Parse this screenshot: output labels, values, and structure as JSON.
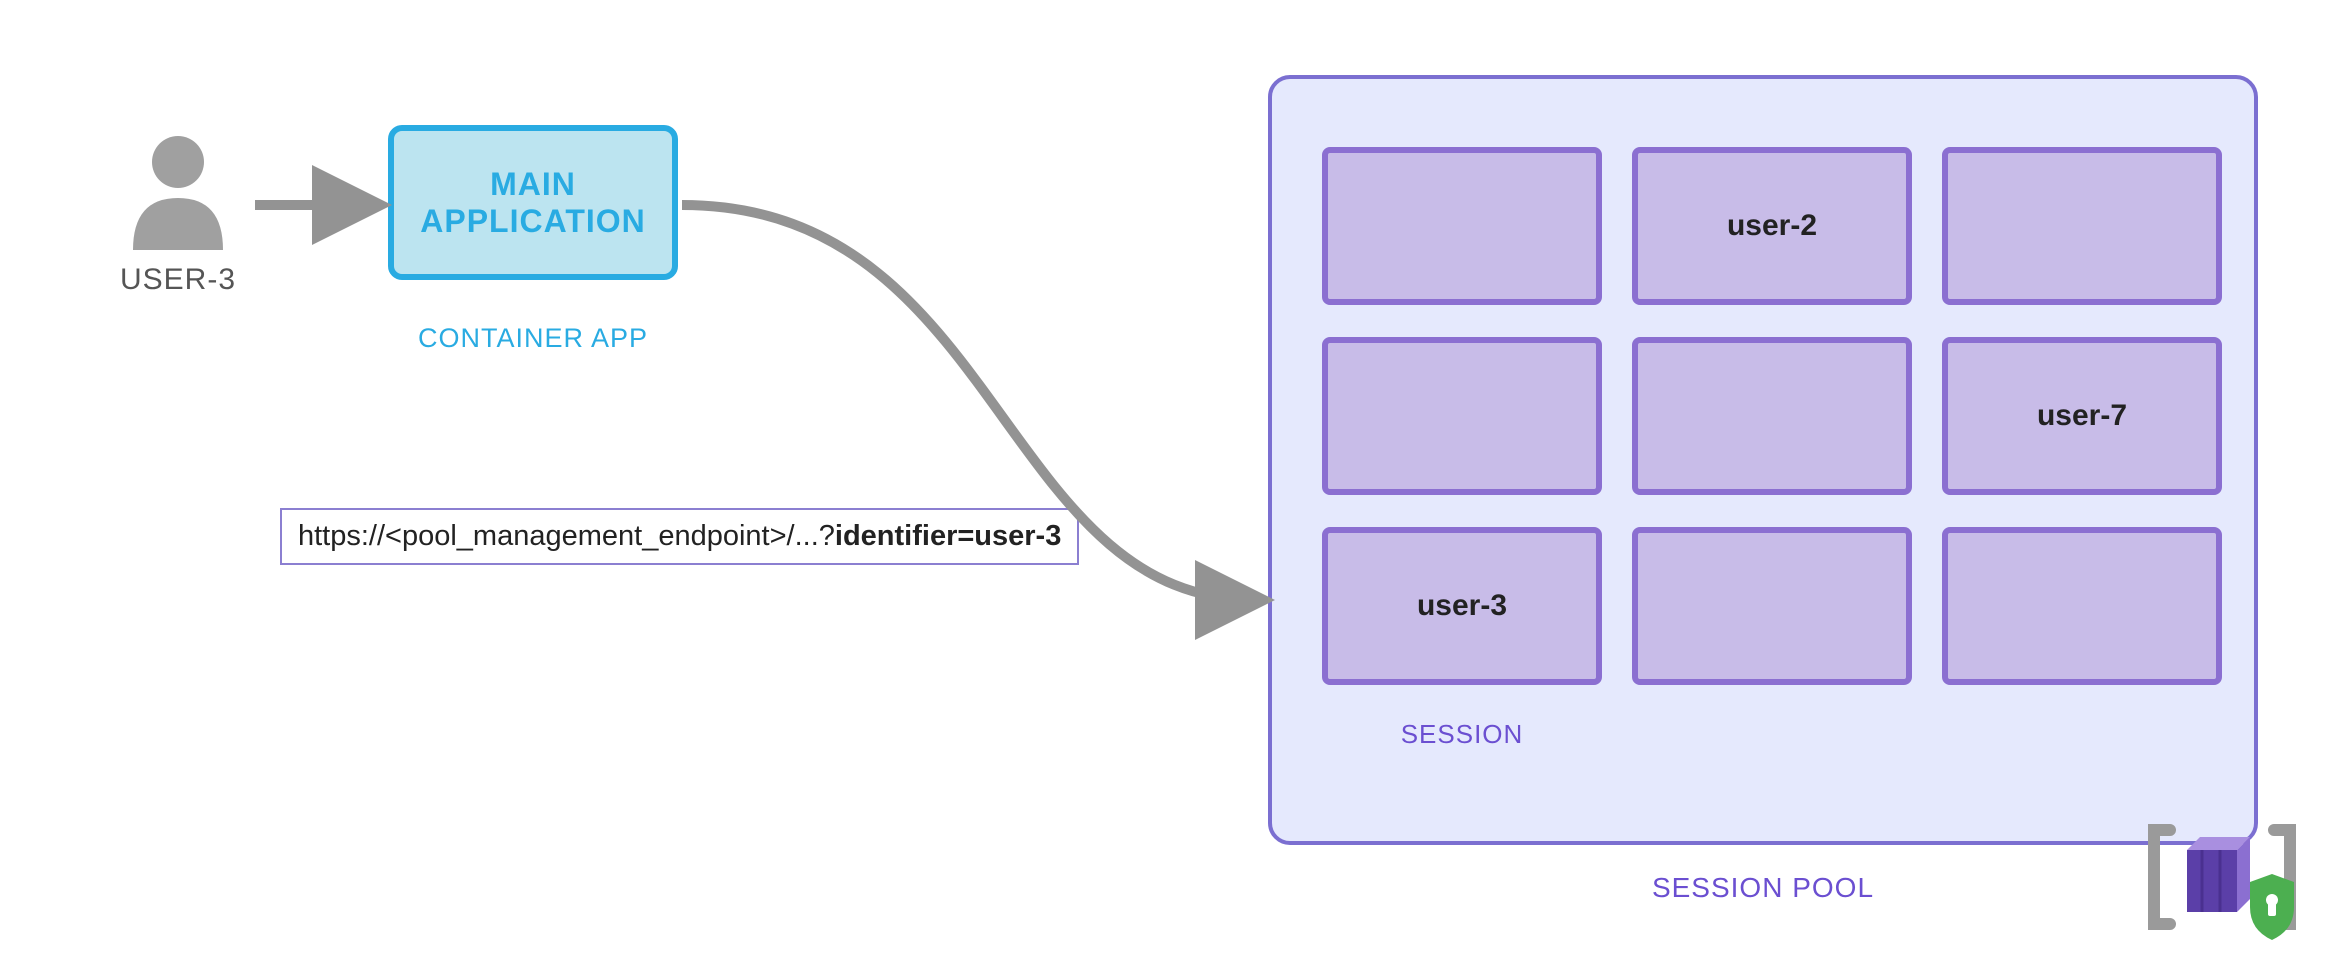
{
  "user": {
    "label": "USER-3"
  },
  "containerApp": {
    "title_line1": "MAIN",
    "title_line2": "APPLICATION",
    "subtitle": "CONTAINER APP"
  },
  "url": {
    "prefix": "https://<pool_management_endpoint>/...?",
    "bold": "identifier=user-3"
  },
  "sessionPool": {
    "poolLabel": "SESSION POOL",
    "sessionLabel": "SESSION",
    "cells": [
      {
        "text": ""
      },
      {
        "text": "user-2"
      },
      {
        "text": ""
      },
      {
        "text": ""
      },
      {
        "text": ""
      },
      {
        "text": "user-7"
      },
      {
        "text": "user-3"
      },
      {
        "text": ""
      },
      {
        "text": ""
      }
    ]
  },
  "colors": {
    "teal": "#29abe2",
    "tealFill": "#bce4f0",
    "purple": "#8b6fd1",
    "purpleFill": "#c8bce8",
    "poolFill": "#e5e9fd",
    "gray": "#939393"
  }
}
